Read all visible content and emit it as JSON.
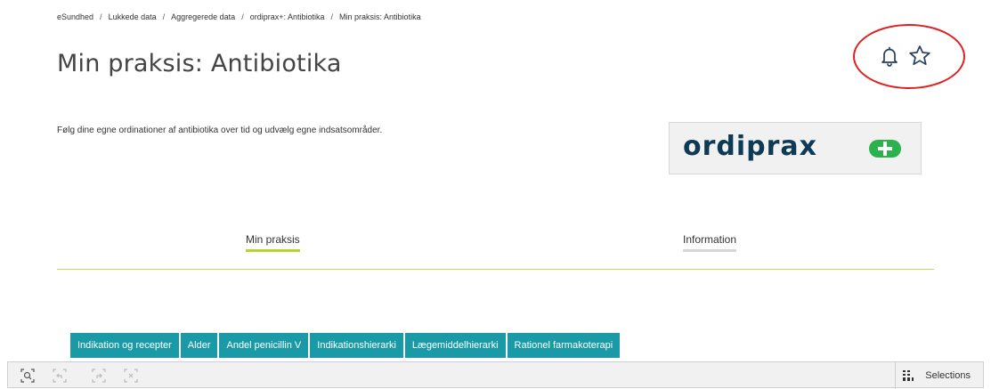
{
  "breadcrumb": {
    "items": [
      "eSundhed",
      "Lukkede data",
      "Aggregerede data",
      "ordiprax+: Antibiotika",
      "Min praksis: Antibiotika"
    ],
    "separator": "/"
  },
  "page": {
    "title": "Min praksis: Antibiotika",
    "description": "Følg dine egne ordinationer af antibiotika over tid og udvælg egne indsatsområder."
  },
  "actions": {
    "icons": [
      "bell-icon",
      "star-icon"
    ],
    "highlight_color": "#e02020"
  },
  "logo": {
    "text": "ordiprax",
    "plus_color": "#2bb24c",
    "text_color": "#0e3a55"
  },
  "tabs": [
    {
      "label": "Min praksis",
      "active": true
    },
    {
      "label": "Information",
      "active": false
    }
  ],
  "subtabs": [
    "Indikation og recepter",
    "Alder",
    "Andel penicillin V",
    "Indikationshierarki",
    "Lægemiddelhierarki",
    "Rationel farmakoterapi"
  ],
  "toolbar": {
    "icons": [
      "smart-search-icon",
      "step-back-icon",
      "step-forward-icon",
      "clear-selections-icon"
    ],
    "selections_label": "Selections"
  },
  "colors": {
    "accent_green": "#b8d430",
    "subtab_teal": "#199aa6"
  }
}
